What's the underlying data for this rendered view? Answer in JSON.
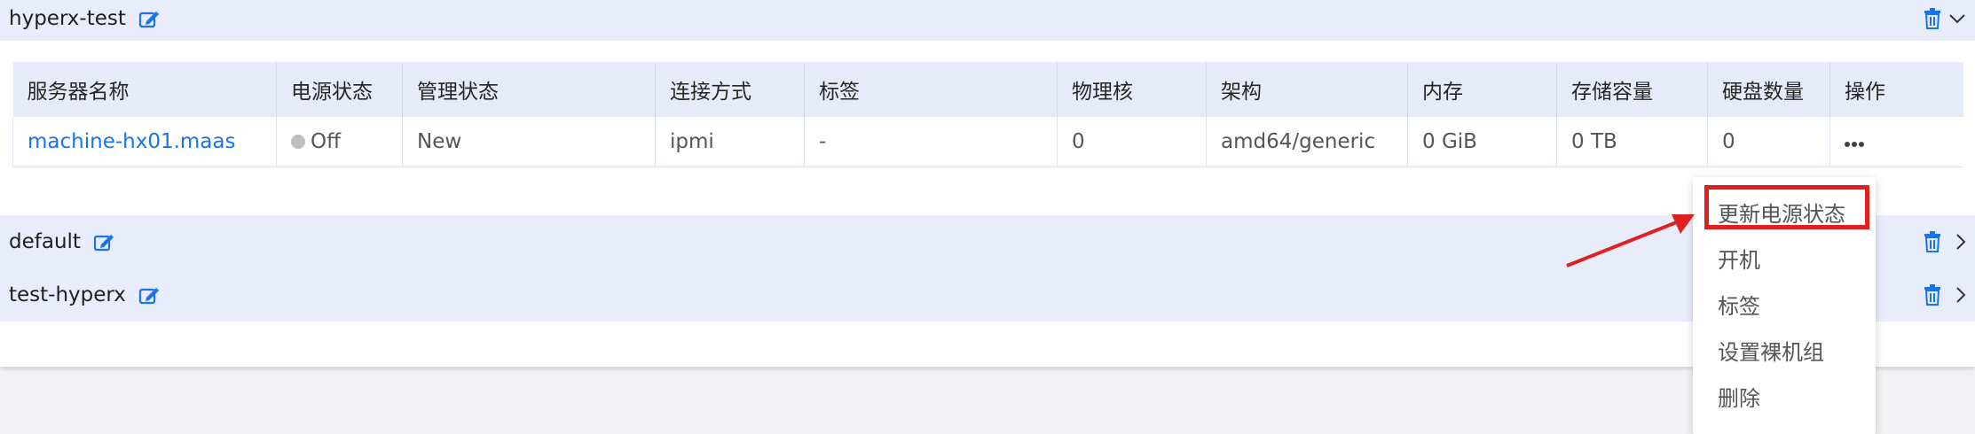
{
  "groups": [
    {
      "name": "hyperx-test",
      "expanded": true
    },
    {
      "name": "default",
      "expanded": false
    },
    {
      "name": "test-hyperx",
      "expanded": false
    }
  ],
  "table": {
    "headers": [
      "服务器名称",
      "电源状态",
      "管理状态",
      "连接方式",
      "标签",
      "物理核",
      "架构",
      "内存",
      "存储容量",
      "硬盘数量",
      "操作"
    ],
    "rows": [
      {
        "name": "machine-hx01.maas",
        "power": "Off",
        "manage": "New",
        "conn": "ipmi",
        "tags": "-",
        "cores": "0",
        "arch": "amd64/generic",
        "memory": "0 GiB",
        "storage": "0 TB",
        "disks": "0",
        "action_icon": "more-icon"
      }
    ]
  },
  "menu": {
    "items": [
      "更新电源状态",
      "开机",
      "标签",
      "设置裸机组",
      "删除"
    ],
    "highlighted_index": 0
  },
  "colors": {
    "accent": "#1a73e8",
    "header_bg": "#e9edfb",
    "highlight": "#e0201f",
    "status_off": "#bfbfbf"
  }
}
